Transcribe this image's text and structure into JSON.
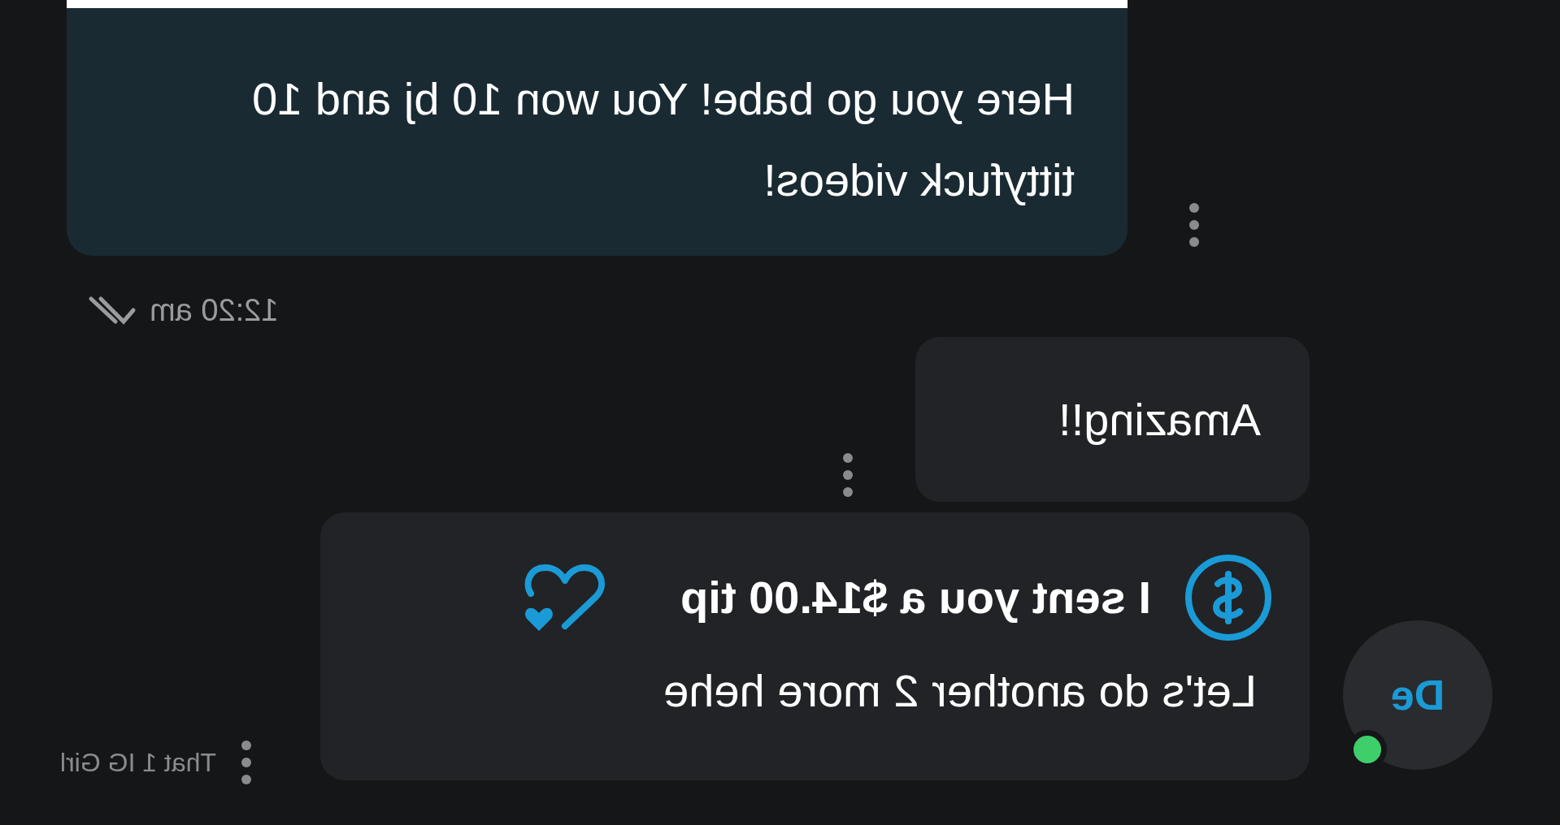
{
  "messages": [
    {
      "kind": "sent",
      "text": "Here you go babe! You won 10 bj and 10 tittyfuck videos!",
      "time": "12:20 am",
      "read": true
    },
    {
      "kind": "received",
      "text": "Amazing!!"
    },
    {
      "kind": "tip",
      "tip_text": "I sent you a $14.00 tip",
      "text": "Let's do another 2 more hehe"
    }
  ],
  "sender": {
    "initials": "De",
    "online": true,
    "name": "That 1 IG Girl"
  }
}
